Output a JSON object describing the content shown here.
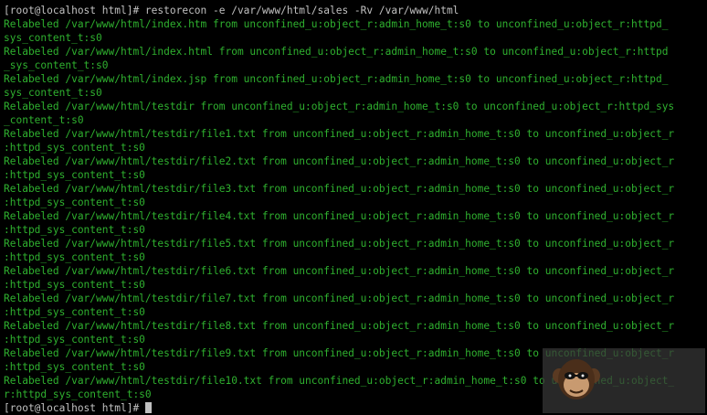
{
  "terminal": {
    "top_partial": {
      "prefix": "",
      "highlight": ""
    },
    "lines": [
      {
        "kind": "prompt",
        "text": "[root@localhost html]# restorecon -e /var/www/html/sales -Rv /var/www/html"
      },
      {
        "kind": "output",
        "text": "Relabeled /var/www/html/index.htm from unconfined_u:object_r:admin_home_t:s0 to unconfined_u:object_r:httpd_"
      },
      {
        "kind": "output",
        "text": "sys_content_t:s0"
      },
      {
        "kind": "output",
        "text": "Relabeled /var/www/html/index.html from unconfined_u:object_r:admin_home_t:s0 to unconfined_u:object_r:httpd"
      },
      {
        "kind": "output",
        "text": "_sys_content_t:s0"
      },
      {
        "kind": "output",
        "text": "Relabeled /var/www/html/index.jsp from unconfined_u:object_r:admin_home_t:s0 to unconfined_u:object_r:httpd_"
      },
      {
        "kind": "output",
        "text": "sys_content_t:s0"
      },
      {
        "kind": "output",
        "text": "Relabeled /var/www/html/testdir from unconfined_u:object_r:admin_home_t:s0 to unconfined_u:object_r:httpd_sys"
      },
      {
        "kind": "output",
        "text": "_content_t:s0"
      },
      {
        "kind": "output",
        "text": "Relabeled /var/www/html/testdir/file1.txt from unconfined_u:object_r:admin_home_t:s0 to unconfined_u:object_r"
      },
      {
        "kind": "output",
        "text": ":httpd_sys_content_t:s0"
      },
      {
        "kind": "output",
        "text": "Relabeled /var/www/html/testdir/file2.txt from unconfined_u:object_r:admin_home_t:s0 to unconfined_u:object_r"
      },
      {
        "kind": "output",
        "text": ":httpd_sys_content_t:s0"
      },
      {
        "kind": "output",
        "text": "Relabeled /var/www/html/testdir/file3.txt from unconfined_u:object_r:admin_home_t:s0 to unconfined_u:object_r"
      },
      {
        "kind": "output",
        "text": ":httpd_sys_content_t:s0"
      },
      {
        "kind": "output",
        "text": "Relabeled /var/www/html/testdir/file4.txt from unconfined_u:object_r:admin_home_t:s0 to unconfined_u:object_r"
      },
      {
        "kind": "output",
        "text": ":httpd_sys_content_t:s0"
      },
      {
        "kind": "output",
        "text": "Relabeled /var/www/html/testdir/file5.txt from unconfined_u:object_r:admin_home_t:s0 to unconfined_u:object_r"
      },
      {
        "kind": "output",
        "text": ":httpd_sys_content_t:s0"
      },
      {
        "kind": "output",
        "text": "Relabeled /var/www/html/testdir/file6.txt from unconfined_u:object_r:admin_home_t:s0 to unconfined_u:object_r"
      },
      {
        "kind": "output",
        "text": ":httpd_sys_content_t:s0"
      },
      {
        "kind": "output",
        "text": "Relabeled /var/www/html/testdir/file7.txt from unconfined_u:object_r:admin_home_t:s0 to unconfined_u:object_r"
      },
      {
        "kind": "output",
        "text": ":httpd_sys_content_t:s0"
      },
      {
        "kind": "output",
        "text": "Relabeled /var/www/html/testdir/file8.txt from unconfined_u:object_r:admin_home_t:s0 to unconfined_u:object_r"
      },
      {
        "kind": "output",
        "text": ":httpd_sys_content_t:s0"
      },
      {
        "kind": "output",
        "text": "Relabeled /var/www/html/testdir/file9.txt from unconfined_u:object_r:admin_home_t:s0 to unconfined_u:object_r"
      },
      {
        "kind": "output",
        "text": ":httpd_sys_content_t:s0"
      },
      {
        "kind": "output",
        "text": "Relabeled /var/www/html/testdir/file10.txt from unconfined_u:object_r:admin_home_t:s0 to unconfined_u:object_"
      },
      {
        "kind": "output",
        "text": "r:httpd_sys_content_t:s0"
      },
      {
        "kind": "prompt",
        "text": "[root@localhost html]# ",
        "cursor": true
      }
    ]
  },
  "colors": {
    "background": "#000000",
    "prompt_text": "#c0c0c0",
    "output_text": "#2fb12f",
    "highlight": "#2a70ff"
  },
  "icons": {
    "watermark": "monkey-face-icon"
  }
}
